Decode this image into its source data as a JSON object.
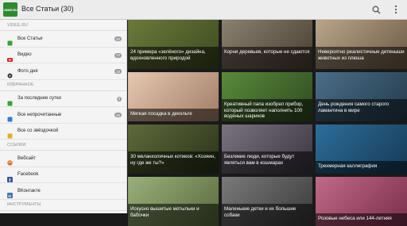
{
  "app": {
    "logo_text": "VIDEE.RU",
    "title": "Все Статьи (30)",
    "colors": {
      "accent": "#2f8a2f",
      "actionbar": "#ececec",
      "sidebar": "#f4f4f4"
    }
  },
  "sidebar": {
    "sections": [
      {
        "header": "VIDEE.RU",
        "items": [
          {
            "label": "Все Статьи",
            "icon": "green-square-icon",
            "badge": "30"
          },
          {
            "label": "Видео",
            "icon": "video-icon",
            "badge": "12"
          },
          {
            "label": "Фото дня",
            "icon": "photo-icon",
            "badge": "18"
          }
        ]
      },
      {
        "header": "ИЗБРАННОЕ",
        "items": [
          {
            "label": "За последние сутки",
            "icon": "green-square-icon",
            "badge": "6"
          },
          {
            "label": "Все непрочитанные",
            "icon": "blue-square-icon",
            "badge": "26"
          },
          {
            "label": "Все со звёздочкой",
            "icon": "yellow-square-icon",
            "badge": ""
          }
        ]
      },
      {
        "header": "ССЫЛКИ",
        "items": [
          {
            "label": "Вебсайт",
            "icon": "web-icon",
            "badge": ""
          },
          {
            "label": "Facebook",
            "icon": "facebook-icon",
            "badge": ""
          },
          {
            "label": "ВКонтакте",
            "icon": "vk-icon",
            "badge": ""
          }
        ]
      },
      {
        "header": "ИНСТРУМЕНТЫ",
        "items": []
      }
    ]
  },
  "grid": {
    "tiles": [
      {
        "caption": "24 примера «зелёного» дизайна, вдохновленного природой",
        "colors": [
          "#6a7a3a",
          "#3e4a22"
        ]
      },
      {
        "caption": "Корни деревьев, которые не сдаются",
        "colors": [
          "#8a8070",
          "#4a4032"
        ]
      },
      {
        "caption": "Невероятно реалистичные детеныши животных из плюша",
        "colors": [
          "#b8a58a",
          "#6e5a44"
        ]
      },
      {
        "caption": "Мягкая посадка в декольте",
        "colors": [
          "#e6c8b0",
          "#a07c66"
        ]
      },
      {
        "caption": "Креативный папа изобрел прибор, который позволяет наполнить 100 водяных шариков",
        "colors": [
          "#5a8a3a",
          "#2e4a22"
        ]
      },
      {
        "caption": "День рождения самого старого ламантина в мире",
        "colors": [
          "#4a6e88",
          "#243a4a"
        ]
      },
      {
        "caption": "30 меланхоличных котиков: «Хозяин, ну где же ты?»",
        "colors": [
          "#5e6a3a",
          "#2a321a"
        ]
      },
      {
        "caption": "Безликие люди, которые будут являться вам в кошмарах",
        "colors": [
          "#7a7480",
          "#3a3440"
        ]
      },
      {
        "caption": "Трехмерная каллиграфия",
        "colors": [
          "#2c6e9a",
          "#173a55"
        ]
      },
      {
        "caption": "Искусно вышитые мотыльки и бабочки",
        "colors": [
          "#9ab07a",
          "#5a6a3e"
        ]
      },
      {
        "caption": "Маленькие детки и их большие собаки",
        "colors": [
          "#7a7a7a",
          "#3a3a3a"
        ]
      },
      {
        "caption": "Розовые небеса или 144-летняя",
        "colors": [
          "#c06a88",
          "#7a2e4a"
        ]
      }
    ]
  }
}
